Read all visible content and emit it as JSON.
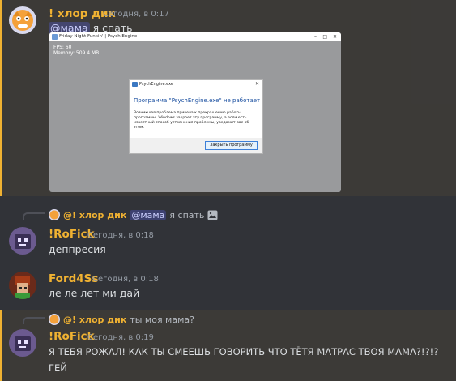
{
  "messages": [
    {
      "author": "! хлор дик",
      "timestamp": "Сегодня, в 0:17",
      "mention": "@мама",
      "text": " я спать",
      "attachment": {
        "window_title": "Friday Night Funkin' | Psych Engine",
        "fps": "FPS: 60",
        "memory": "Memory: 509.4 MB",
        "dialog": {
          "title": "PsychEngine.exe",
          "heading": "Программа \"PsychEngine.exe\" не работает",
          "body": "Возникшая проблема привела к прекращению работы программы. Windows закроет эту программу, а если есть известный способ устранения проблемы, уведомит вас об этом.",
          "button": "Закрыть программу"
        }
      }
    },
    {
      "reply": {
        "author": "@! хлор дик",
        "mention": "@мама",
        "text": "я спать",
        "icon": "image-icon"
      },
      "author": "!RoFick",
      "timestamp": "Сегодня, в 0:18",
      "text": "деппресия"
    },
    {
      "author": "Ford4Ss",
      "timestamp": "Сегодня, в 0:18",
      "text": "ле ле лет ми дай"
    },
    {
      "reply": {
        "author": "@! хлор дик",
        "text": "ты моя мама?"
      },
      "author": "!RoFick",
      "timestamp": "Сегодня, в 0:19",
      "text_line1": "Я ТЕБЯ РОЖАЛ! КАК ТЫ СМЕЕШЬ ГОВОРИТЬ ЧТО ТЁТЯ МАТРАС ТВОЯ МАМА?!?!?",
      "text_line2": "ГЕЙ"
    }
  ],
  "colors": {
    "background": "#313338",
    "username_gold": "#f0b232",
    "mention_bar": "#f0b232",
    "timestamp": "#949ba4"
  }
}
